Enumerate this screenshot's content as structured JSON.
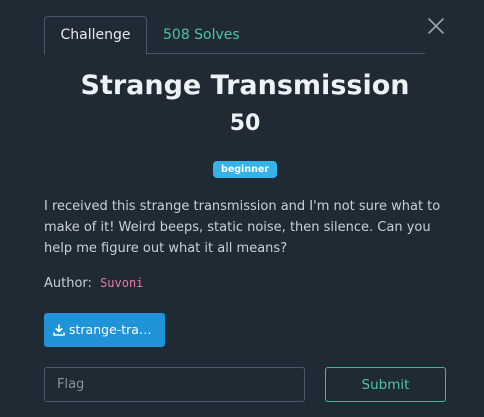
{
  "tabs": {
    "challenge_label": "Challenge",
    "solves_label": "508 Solves"
  },
  "challenge": {
    "title": "Strange Transmission",
    "points": "50",
    "difficulty_badge": "beginner",
    "description": "I received this strange transmission and I'm not sure what to make of it! Weird beeps, static noise, then silence. Can you help me figure out what it all means?",
    "author_label": "Author:",
    "author_name": "Suvoni"
  },
  "download": {
    "label": "strange-tra…",
    "icon": "download-icon"
  },
  "flag_form": {
    "placeholder": "Flag",
    "value": "",
    "submit_label": "Submit"
  },
  "icons": {
    "close": "close-icon"
  },
  "colors": {
    "background": "#1f2a35",
    "accent_green": "#4fc3a3",
    "badge_blue": "#34b3e8",
    "download_blue": "#2193d8",
    "author_pink": "#e879a4"
  }
}
